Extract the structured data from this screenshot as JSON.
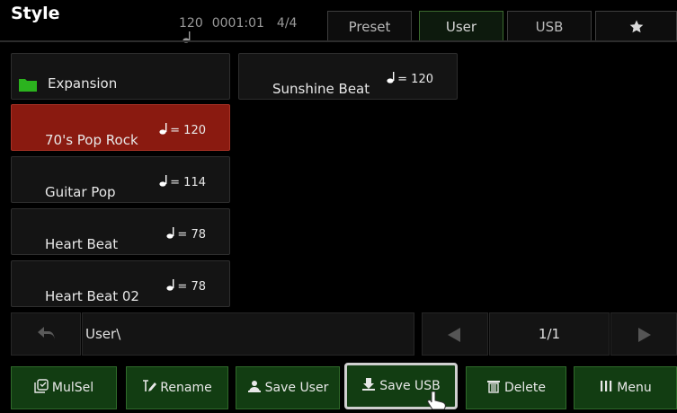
{
  "header": {
    "title": "Style",
    "tempo": "120",
    "measure": "0001:01",
    "time_signature": "4/4",
    "tabs": [
      {
        "label": "Preset",
        "active": false
      },
      {
        "label": "User",
        "active": true
      },
      {
        "label": "USB",
        "active": false
      },
      {
        "icon": "star-icon",
        "active": false
      }
    ]
  },
  "folders": [
    {
      "label": "Expansion",
      "icon": "folder-icon"
    }
  ],
  "styles": [
    {
      "name": "70's Pop Rock",
      "tempo": "= 120",
      "selected": true
    },
    {
      "name": "Guitar Pop",
      "tempo": "= 114",
      "selected": false
    },
    {
      "name": "Heart Beat",
      "tempo": "= 78",
      "selected": false
    },
    {
      "name": "Heart Beat 02",
      "tempo": "= 78",
      "selected": false
    },
    {
      "name": "Sunshine Beat",
      "tempo": "= 120",
      "selected": false
    }
  ],
  "nav": {
    "path": "User\\",
    "page": "1/1"
  },
  "buttons": {
    "mulsel": "MulSel",
    "rename": "Rename",
    "save_user": "Save User",
    "save_usb": "Save USB",
    "delete": "Delete",
    "menu": "Menu"
  },
  "colors": {
    "selected": "#8a1a10",
    "active_tab": "#3b6a2e",
    "button_bg": "#123d12",
    "folder": "#2bb31e"
  }
}
